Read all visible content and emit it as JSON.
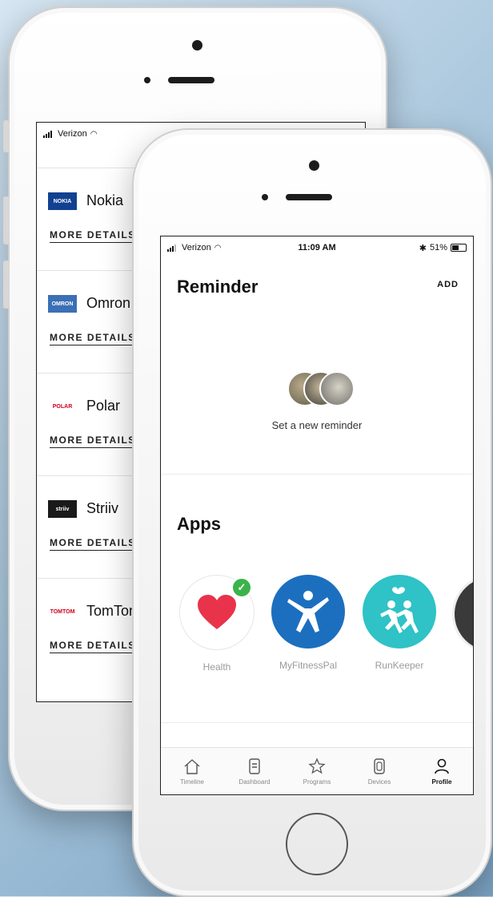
{
  "back_phone": {
    "status": {
      "carrier": "Verizon"
    },
    "devices": [
      {
        "name": "Nokia",
        "logo_text": "NOKIA",
        "logo_bg": "#124191",
        "logo_color": "#ffffff",
        "link": "MORE DETAILS"
      },
      {
        "name": "Omron",
        "logo_text": "OMRON",
        "logo_bg": "#3b6fb6",
        "logo_color": "#ffffff",
        "link": "MORE DETAILS"
      },
      {
        "name": "Polar",
        "logo_text": "POLAR",
        "logo_bg": "#ffffff",
        "logo_color": "#d0021b",
        "link": "MORE DETAILS"
      },
      {
        "name": "Striiv",
        "logo_text": "striiv",
        "logo_bg": "#1a1a1a",
        "logo_color": "#ffffff",
        "link": "MORE DETAILS"
      },
      {
        "name": "TomTom",
        "logo_text": "TOMTOM",
        "logo_bg": "#ffffff",
        "logo_color": "#d0021b",
        "link": "MORE DETAILS"
      }
    ]
  },
  "front_phone": {
    "status": {
      "carrier": "Verizon",
      "time": "11:09 AM",
      "battery": "51%"
    },
    "reminder": {
      "title": "Reminder",
      "add_label": "ADD",
      "empty_text": "Set a new reminder"
    },
    "apps": {
      "title": "Apps",
      "items": [
        {
          "label": "Health",
          "icon": "heart-icon",
          "bg": "#ffffff",
          "connected": true
        },
        {
          "label": "MyFitnessPal",
          "icon": "person-leap-icon",
          "bg": "#1c6fbf",
          "connected": false
        },
        {
          "label": "RunKeeper",
          "icon": "runners-icon",
          "bg": "#2fc2c6",
          "connected": false
        }
      ]
    },
    "tabs": [
      {
        "label": "Timeline",
        "icon": "home-icon",
        "active": false
      },
      {
        "label": "Dashboard",
        "icon": "document-icon",
        "active": false
      },
      {
        "label": "Programs",
        "icon": "star-icon",
        "active": false
      },
      {
        "label": "Devices",
        "icon": "watch-icon",
        "active": false
      },
      {
        "label": "Profile",
        "icon": "person-icon",
        "active": true
      }
    ]
  },
  "colors": {
    "check": "#3bb34a",
    "heart": "#e8334a"
  }
}
